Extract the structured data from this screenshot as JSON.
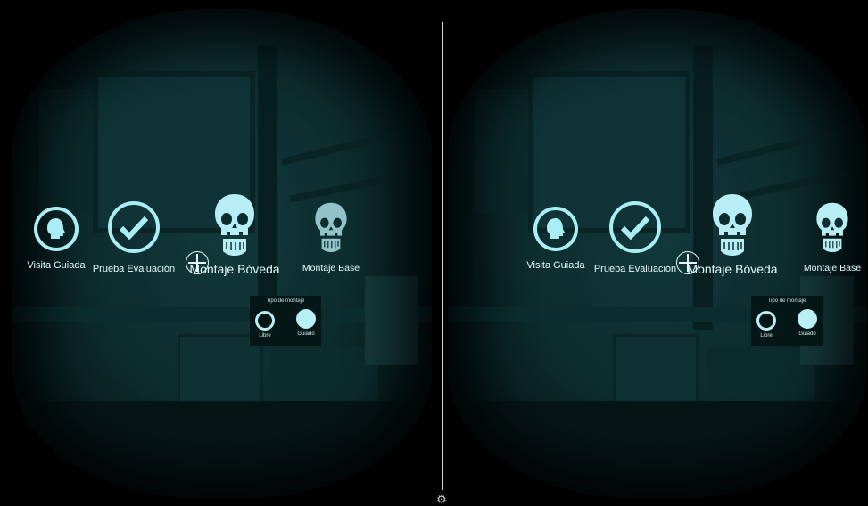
{
  "menu": {
    "items": [
      {
        "label": "Visita Guiada",
        "icon": "skull-side-icon"
      },
      {
        "label": "Prueba Evaluación",
        "icon": "checkmark-icon"
      },
      {
        "label": "Montaje Bóveda",
        "icon": "skull-front-icon"
      },
      {
        "label": "Montaje Base",
        "icon": "skull-front-icon"
      }
    ]
  },
  "tipo_montaje": {
    "title": "Tipo de montaje",
    "options": [
      {
        "label": "Libre",
        "selected": false
      },
      {
        "label": "Guiado",
        "selected": true
      }
    ]
  },
  "colors": {
    "accent": "#a9eef5",
    "background": "#0d2c2e"
  },
  "settings_icon": "gear-icon"
}
